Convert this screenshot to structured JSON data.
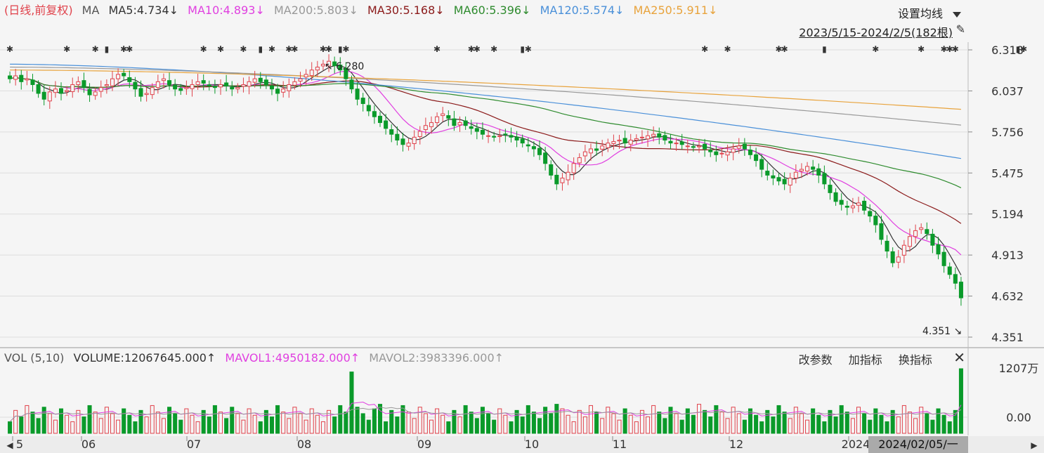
{
  "header": {
    "title": "(日线,前复权)",
    "ma_label": "MA",
    "ma": [
      {
        "text": "MA5:4.734↓",
        "color": "#333333"
      },
      {
        "text": "MA10:4.893↓",
        "color": "#e040e0"
      },
      {
        "text": "MA200:5.803↓",
        "color": "#999999"
      },
      {
        "text": "MA30:5.168↓",
        "color": "#8b1a1a"
      },
      {
        "text": "MA60:5.396↓",
        "color": "#2e8b2e"
      },
      {
        "text": "MA120:5.574↓",
        "color": "#4a90d9"
      },
      {
        "text": "MA250:5.911↓",
        "color": "#e8a33c"
      }
    ],
    "settings_label": "设置均线",
    "range_label": "2023/5/15-2024/2/5(182根)"
  },
  "volume_header": {
    "title": "VOL (5,10)",
    "volume": {
      "text": "VOLUME:12067645.000↑",
      "color": "#333333"
    },
    "mavol1": {
      "text": "MAVOL1:4950182.000↑",
      "color": "#e040e0"
    },
    "mavol2": {
      "text": "MAVOL2:3983396.000↑",
      "color": "#999999"
    },
    "tools": [
      "改参数",
      "加指标",
      "换指标"
    ],
    "close": "✕"
  },
  "price_axis": {
    "ticks": [
      "6.318",
      "6.037",
      "5.756",
      "5.475",
      "5.194",
      "4.913",
      "4.632",
      "4.351"
    ]
  },
  "volume_axis": {
    "ticks": [
      "1207万",
      "0.00"
    ]
  },
  "x_axis": {
    "labels": [
      "5",
      "06",
      "07",
      "08",
      "09",
      "10",
      "11",
      "12",
      "2024"
    ],
    "cursor_label": "2024/02/05/一"
  },
  "annotations": {
    "high": "6.280",
    "low": "4.351"
  },
  "colors": {
    "up": "#e0424b",
    "down": "#0a9a2a",
    "ma5": "#333333",
    "ma10": "#e040e0",
    "ma30": "#8b1a1a",
    "ma60": "#2e8b2e",
    "ma120": "#4a90d9",
    "ma200": "#999999",
    "ma250": "#e8a33c"
  },
  "chart_data": {
    "type": "candlestick",
    "title": "(日线,前复权)",
    "x_range": [
      "2023/5/15",
      "2024/2/5"
    ],
    "bar_count": 182,
    "ylim": [
      4.351,
      6.318
    ],
    "closes_approx": [
      6.12,
      6.14,
      6.1,
      6.12,
      6.08,
      6.02,
      5.98,
      6.03,
      6.05,
      6.02,
      6.04,
      6.08,
      6.1,
      6.06,
      6.01,
      6.03,
      6.06,
      6.08,
      6.12,
      6.15,
      6.14,
      6.1,
      6.05,
      6.0,
      6.02,
      6.06,
      6.1,
      6.12,
      6.08,
      6.05,
      6.04,
      6.06,
      6.08,
      6.1,
      6.09,
      6.07,
      6.06,
      6.08,
      6.07,
      6.05,
      6.06,
      6.08,
      6.1,
      6.12,
      6.1,
      6.08,
      6.05,
      6.02,
      6.05,
      6.08,
      6.1,
      6.12,
      6.15,
      6.18,
      6.2,
      6.22,
      6.24,
      6.21,
      6.18,
      6.12,
      6.05,
      5.98,
      5.95,
      5.9,
      5.86,
      5.82,
      5.78,
      5.74,
      5.7,
      5.67,
      5.68,
      5.72,
      5.76,
      5.8,
      5.82,
      5.86,
      5.88,
      5.85,
      5.8,
      5.82,
      5.8,
      5.78,
      5.76,
      5.74,
      5.73,
      5.72,
      5.73,
      5.74,
      5.72,
      5.7,
      5.68,
      5.66,
      5.64,
      5.6,
      5.54,
      5.46,
      5.4,
      5.44,
      5.48,
      5.54,
      5.58,
      5.62,
      5.64,
      5.63,
      5.66,
      5.68,
      5.69,
      5.7,
      5.68,
      5.7,
      5.71,
      5.72,
      5.73,
      5.74,
      5.72,
      5.7,
      5.68,
      5.68,
      5.67,
      5.66,
      5.65,
      5.66,
      5.64,
      5.62,
      5.6,
      5.61,
      5.62,
      5.64,
      5.66,
      5.64,
      5.6,
      5.56,
      5.5,
      5.46,
      5.44,
      5.42,
      5.4,
      5.44,
      5.48,
      5.5,
      5.52,
      5.5,
      5.46,
      5.4,
      5.34,
      5.28,
      5.26,
      5.24,
      5.25,
      5.27,
      5.22,
      5.18,
      5.12,
      5.02,
      4.94,
      4.86,
      4.9,
      4.98,
      5.04,
      5.08,
      5.1,
      5.06,
      4.98,
      4.92,
      4.84,
      4.78,
      4.72,
      4.62
    ],
    "series": [
      {
        "name": "MA5",
        "last": 4.734
      },
      {
        "name": "MA10",
        "last": 4.893
      },
      {
        "name": "MA200",
        "last": 5.803
      },
      {
        "name": "MA30",
        "last": 5.168
      },
      {
        "name": "MA60",
        "last": 5.396
      },
      {
        "name": "MA120",
        "last": 5.574
      },
      {
        "name": "MA250",
        "last": 5.911
      }
    ],
    "high": 6.28,
    "low": 4.351,
    "volume": {
      "last": 12067645.0,
      "mavol1": 4950182.0,
      "mavol2": 3983396.0,
      "ylim_label_top": "1207万"
    }
  }
}
